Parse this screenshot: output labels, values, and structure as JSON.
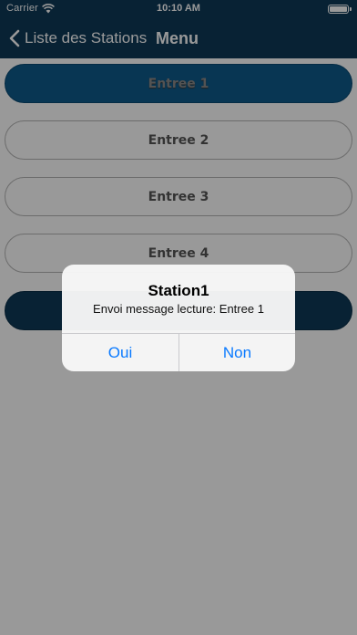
{
  "status_bar": {
    "carrier": "Carrier",
    "time": "10:10 AM"
  },
  "nav": {
    "back_label": "Liste des Stations",
    "title": "Menu"
  },
  "entries": [
    {
      "label": "Entree 1"
    },
    {
      "label": "Entree 2"
    },
    {
      "label": "Entree 3"
    },
    {
      "label": "Entree 4"
    },
    {
      "label": ""
    }
  ],
  "alert": {
    "title": "Station1",
    "message": "Envoi message lecture: Entree 1",
    "buttons": [
      "Oui",
      "Non"
    ]
  },
  "colors": {
    "navbar": "#0e3958",
    "accent": "#0a7aff",
    "selected_button": "#0e5a8a"
  },
  "icons": [
    "wifi-icon",
    "battery-icon",
    "chevron-left-icon"
  ]
}
